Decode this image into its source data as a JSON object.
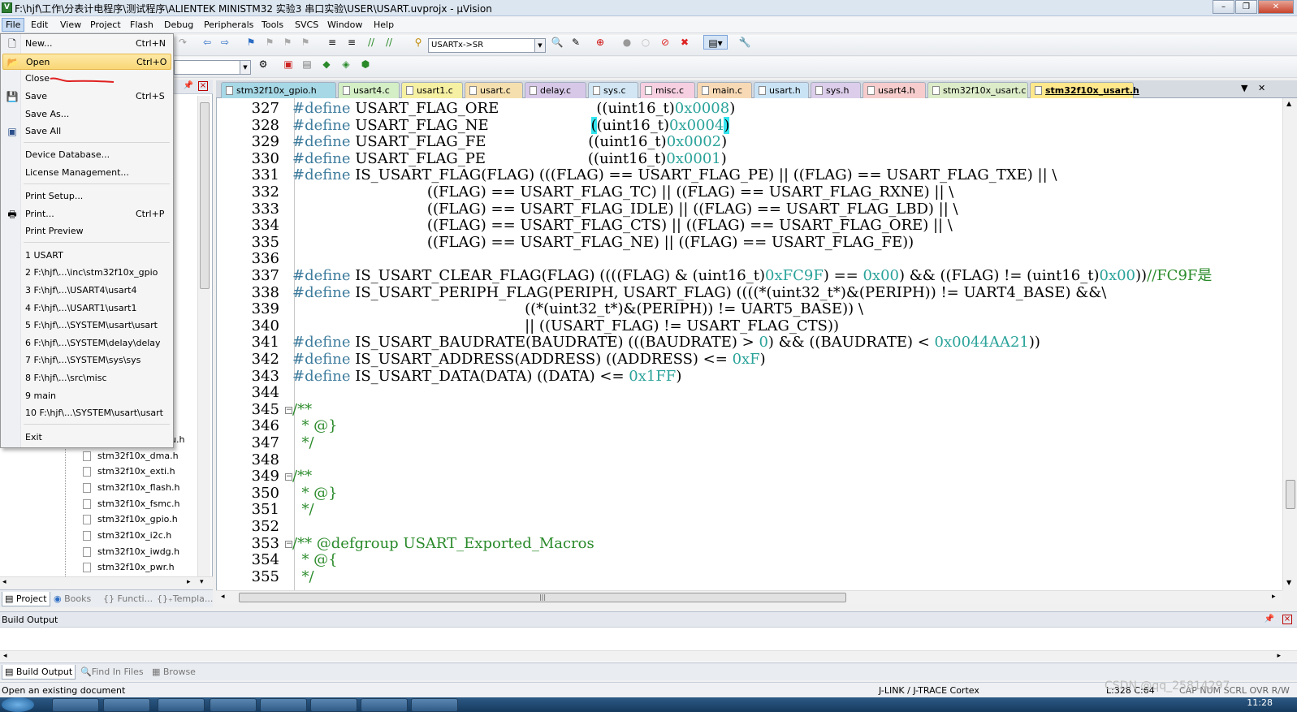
{
  "window": {
    "title": "F:\\hjf\\工作\\分表计电程序\\测试程序\\ALIENTEK MINISTM32 实验3 串口实验\\USER\\USART.uvprojx - µVision",
    "min_icon": "minimize-icon",
    "max_icon": "restore-icon",
    "close_icon": "close-icon"
  },
  "menubar": [
    "File",
    "Edit",
    "View",
    "Project",
    "Flash",
    "Debug",
    "Peripherals",
    "Tools",
    "SVCS",
    "Window",
    "Help"
  ],
  "toolbar": {
    "symbol_combo": "USARTx->SR"
  },
  "file_menu": {
    "items": [
      {
        "label": "New...",
        "shortcut": "Ctrl+N",
        "icon": "new-file-icon"
      },
      {
        "label": "Open",
        "shortcut": "Ctrl+O",
        "icon": "folder-open-icon"
      },
      {
        "label": "Close",
        "shortcut": ""
      },
      {
        "label": "Save",
        "shortcut": "Ctrl+S",
        "icon": "floppy-disk-icon"
      },
      {
        "label": "Save As...",
        "shortcut": ""
      },
      {
        "label": "Save All",
        "shortcut": "",
        "icon": "save-all-icon"
      },
      {
        "label": "Device Database...",
        "shortcut": ""
      },
      {
        "label": "License Management...",
        "shortcut": ""
      },
      {
        "label": "Print Setup...",
        "shortcut": ""
      },
      {
        "label": "Print...",
        "shortcut": "Ctrl+P",
        "icon": "printer-icon"
      },
      {
        "label": "Print Preview",
        "shortcut": ""
      },
      {
        "label": "1 USART",
        "shortcut": ""
      },
      {
        "label": "2 F:\\hjf\\...\\inc\\stm32f10x_gpio",
        "shortcut": ""
      },
      {
        "label": "3 F:\\hjf\\...\\USART4\\usart4",
        "shortcut": ""
      },
      {
        "label": "4 F:\\hjf\\...\\USART1\\usart1",
        "shortcut": ""
      },
      {
        "label": "5 F:\\hjf\\...\\SYSTEM\\usart\\usart",
        "shortcut": ""
      },
      {
        "label": "6 F:\\hjf\\...\\SYSTEM\\delay\\delay",
        "shortcut": ""
      },
      {
        "label": "7 F:\\hjf\\...\\SYSTEM\\sys\\sys",
        "shortcut": ""
      },
      {
        "label": "8 F:\\hjf\\...\\src\\misc",
        "shortcut": ""
      },
      {
        "label": "9 main",
        "shortcut": ""
      },
      {
        "label": "10 F:\\hjf\\...\\SYSTEM\\usart\\usart",
        "shortcut": ""
      },
      {
        "label": "Exit",
        "shortcut": ""
      }
    ]
  },
  "project_tree": {
    "partial": "cu.h",
    "files": [
      "stm32f10x_dma.h",
      "stm32f10x_exti.h",
      "stm32f10x_flash.h",
      "stm32f10x_fsmc.h",
      "stm32f10x_gpio.h",
      "stm32f10x_i2c.h",
      "stm32f10x_iwdg.h",
      "stm32f10x_pwr.h"
    ]
  },
  "left_tabs": [
    "Project",
    "Books",
    "Functi...",
    "Templa..."
  ],
  "editor_tabs": [
    {
      "label": "stm32f10x_gpio.h",
      "color": "#a6d8e6"
    },
    {
      "label": "usart4.c",
      "color": "#d4eec5"
    },
    {
      "label": "usart1.c",
      "color": "#f6f0a3"
    },
    {
      "label": "usart.c",
      "color": "#f5dfae"
    },
    {
      "label": "delay.c",
      "color": "#d7c8e8"
    },
    {
      "label": "sys.c",
      "color": "#d2e6f4"
    },
    {
      "label": "misc.c",
      "color": "#f6cfe0"
    },
    {
      "label": "main.c",
      "color": "#f8d9b5"
    },
    {
      "label": "usart.h",
      "color": "#c9e3f5"
    },
    {
      "label": "sys.h",
      "color": "#dccdea"
    },
    {
      "label": "usart4.h",
      "color": "#f6cccc"
    },
    {
      "label": "stm32f10x_usart.c",
      "color": "#dcecc9"
    },
    {
      "label": "stm32f10x_usart.h",
      "color": "#ffe88c"
    }
  ],
  "code_lines": [
    {
      "n": "327",
      "html": "<span class=\"kw\">#define</span> USART_FLAG_ORE                     ((uint16_t)<span class=\"hex\">0x0008</span>)"
    },
    {
      "n": "328",
      "html": "<span class=\"kw\">#define</span> USART_FLAG_NE                      <span class=\"br\">(</span>(uint16_t)<span class=\"hex\">0x0004</span><span class=\"br\">)</span>"
    },
    {
      "n": "329",
      "html": "<span class=\"kw\">#define</span> USART_FLAG_FE                      ((uint16_t)<span class=\"hex\">0x0002</span>)"
    },
    {
      "n": "330",
      "html": "<span class=\"kw\">#define</span> USART_FLAG_PE                      ((uint16_t)<span class=\"hex\">0x0001</span>)"
    },
    {
      "n": "331",
      "html": "<span class=\"kw\">#define</span> IS_USART_FLAG(FLAG) (((FLAG) == USART_FLAG_PE) || ((FLAG) == USART_FLAG_TXE) || \\"
    },
    {
      "n": "332",
      "html": "                             ((FLAG) == USART_FLAG_TC) || ((FLAG) == USART_FLAG_RXNE) || \\"
    },
    {
      "n": "333",
      "html": "                             ((FLAG) == USART_FLAG_IDLE) || ((FLAG) == USART_FLAG_LBD) || \\"
    },
    {
      "n": "334",
      "html": "                             ((FLAG) == USART_FLAG_CTS) || ((FLAG) == USART_FLAG_ORE) || \\"
    },
    {
      "n": "335",
      "html": "                             ((FLAG) == USART_FLAG_NE) || ((FLAG) == USART_FLAG_FE))"
    },
    {
      "n": "336",
      "html": ""
    },
    {
      "n": "337",
      "html": "<span class=\"kw\">#define</span> IS_USART_CLEAR_FLAG(FLAG) ((((FLAG) &amp; (uint16_t)<span class=\"hex\">0xFC9F</span>) == <span class=\"hex\">0x00</span>) &amp;&amp; ((FLAG) != (uint16_t)<span class=\"hex\">0x00</span>))<span class=\"cmt\">//FC9F是</span>"
    },
    {
      "n": "338",
      "html": "<span class=\"kw\">#define</span> IS_USART_PERIPH_FLAG(PERIPH, USART_FLAG) ((((*(uint32_t*)&amp;(PERIPH)) != UART4_BASE) &amp;&amp;\\"
    },
    {
      "n": "339",
      "html": "                                                  ((*(uint32_t*)&amp;(PERIPH)) != UART5_BASE)) \\"
    },
    {
      "n": "340",
      "html": "                                                  || ((USART_FLAG) != USART_FLAG_CTS))"
    },
    {
      "n": "341",
      "html": "<span class=\"kw\">#define</span> IS_USART_BAUDRATE(BAUDRATE) (((BAUDRATE) &gt; <span class=\"hex\">0</span>) &amp;&amp; ((BAUDRATE) &lt; <span class=\"hex\">0x0044AA21</span>))"
    },
    {
      "n": "342",
      "html": "<span class=\"kw\">#define</span> IS_USART_ADDRESS(ADDRESS) ((ADDRESS) &lt;= <span class=\"hex\">0xF</span>)"
    },
    {
      "n": "343",
      "html": "<span class=\"kw\">#define</span> IS_USART_DATA(DATA) ((DATA) &lt;= <span class=\"hex\">0x1FF</span>)"
    },
    {
      "n": "344",
      "html": ""
    },
    {
      "n": "345",
      "html": "<span class=\"cmt\">/**</span>"
    },
    {
      "n": "346",
      "html": "<span class=\"cmt\">  * @}</span>"
    },
    {
      "n": "347",
      "html": "<span class=\"cmt\">  */</span>"
    },
    {
      "n": "348",
      "html": ""
    },
    {
      "n": "349",
      "html": "<span class=\"cmt\">/**</span>"
    },
    {
      "n": "350",
      "html": "<span class=\"cmt\">  * @}</span>"
    },
    {
      "n": "351",
      "html": "<span class=\"cmt\">  */</span>"
    },
    {
      "n": "352",
      "html": ""
    },
    {
      "n": "353",
      "html": "<span class=\"cmt\">/** @defgroup USART_Exported_Macros</span>"
    },
    {
      "n": "354",
      "html": "<span class=\"cmt\">  * @{</span>"
    },
    {
      "n": "355",
      "html": "<span class=\"cmt\">  */</span>"
    }
  ],
  "build_output": {
    "title": "Build Output"
  },
  "bottom_tabs": [
    "Build Output",
    "Find In Files",
    "Browse"
  ],
  "status": {
    "message": "Open an existing document",
    "debugger": "J-LINK / J-TRACE Cortex",
    "position": "L:328 C:64",
    "flags": "CAP  NUM  SCRL  OVR  R/W"
  },
  "taskbar": {
    "time": "11:28"
  },
  "watermark": "CSDN @qq_25814297"
}
